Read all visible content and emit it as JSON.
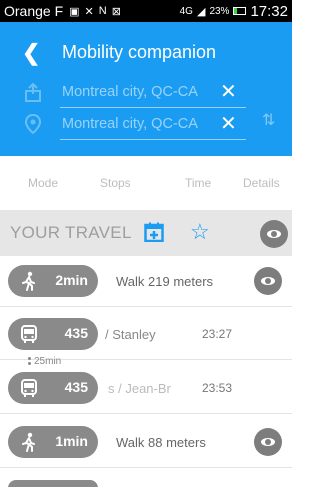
{
  "status_bar": {
    "carrier": "Orange F",
    "network": "4G",
    "battery": "23%",
    "time": "17:32"
  },
  "header": {
    "title": "Mobility companion",
    "from": "Montreal city, QC-CA",
    "to": "Montreal city, QC-CA",
    "clear_glyph": "✕"
  },
  "columns": {
    "mode": "Mode",
    "stops": "Stops",
    "time": "Time",
    "details": "Details"
  },
  "travel": {
    "label": "YOUR TRAVEL",
    "star_glyph": "☆"
  },
  "rows": [
    {
      "mode": "walk",
      "value": "2min",
      "desc": "Walk 219 meters",
      "details": true
    },
    {
      "mode": "bus",
      "value": "435",
      "stop": "/ Stanley",
      "time": "23:27"
    },
    {
      "mode": "bus",
      "value": "435",
      "stop": "s / Jean-Br",
      "time": "23:53"
    },
    {
      "mode": "walk",
      "value": "1min",
      "desc": "Walk 88 meters",
      "details": true
    }
  ],
  "wait": "25min",
  "colors": {
    "accent": "#1a9cf2",
    "pill": "#8a8a8a",
    "travel_bar": "#e6e6e6"
  }
}
